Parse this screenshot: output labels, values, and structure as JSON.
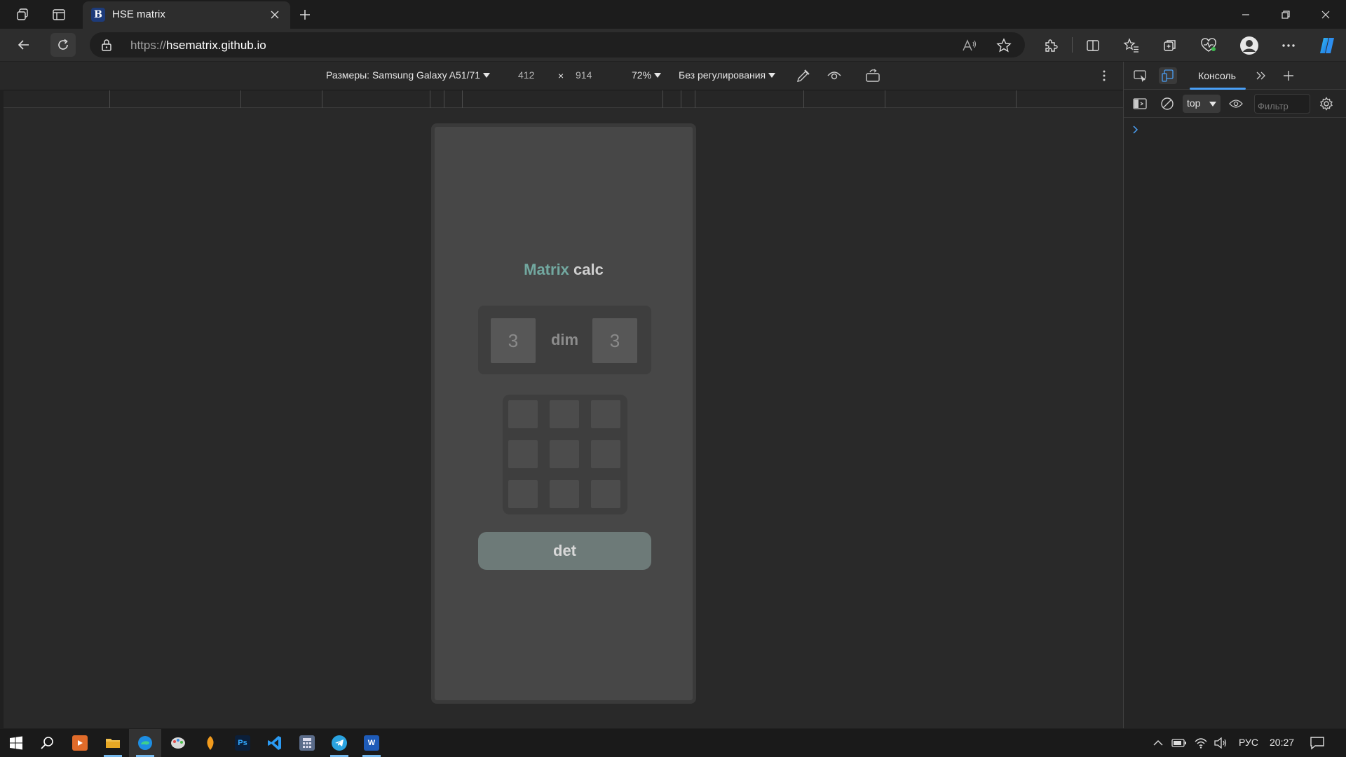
{
  "browser": {
    "tab_title": "HSE matrix",
    "favicon_letter": "B",
    "url_scheme": "https://",
    "url_host": "hsematrix.github.io"
  },
  "device_toolbar": {
    "dimensions_label": "Размеры: Samsung Galaxy A51/71",
    "width": "412",
    "times": "×",
    "height": "914",
    "zoom": "72%",
    "throttling": "Без регулирования"
  },
  "app": {
    "title_accent": "Matrix",
    "title_rest": " calc",
    "rows": "3",
    "dim_label": "dim",
    "cols": "3",
    "det_label": "det"
  },
  "devtools": {
    "tab_console": "Консоль",
    "context": "top",
    "filter_placeholder": "Фильтр"
  },
  "taskbar": {
    "language": "РУС",
    "time": "20:27",
    "apps": [
      "start",
      "search",
      "media",
      "explorer",
      "edge",
      "paint",
      "fl-studio",
      "photoshop",
      "vscode",
      "calculator",
      "telegram",
      "word"
    ]
  }
}
